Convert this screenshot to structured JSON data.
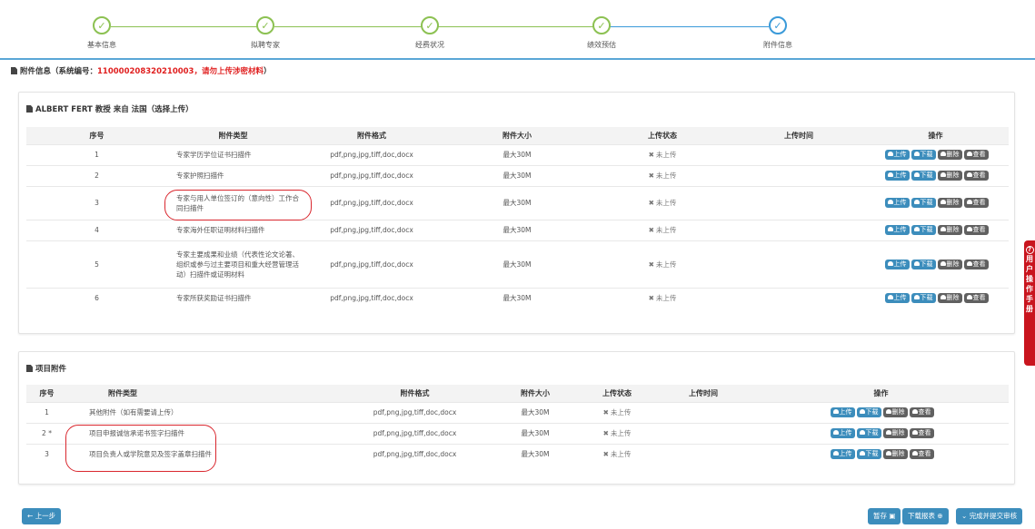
{
  "stepper": {
    "steps": [
      {
        "label": "基本信息"
      },
      {
        "label": "拟聘专家"
      },
      {
        "label": "经费状况"
      },
      {
        "label": "绩效预估"
      },
      {
        "label": "附件信息"
      }
    ]
  },
  "heading": {
    "prefix": "附件信息（系统编号：",
    "red_text": "110000208320210003，请勿上传涉密材料",
    "suffix": "）"
  },
  "expert_panel": {
    "title": "ALBERT FERT 教授 来自 法国（选择上传）",
    "columns": [
      "序号",
      "附件类型",
      "附件格式",
      "附件大小",
      "上传状态",
      "上传时间",
      "操作"
    ],
    "rows": [
      {
        "no": "1",
        "type": "专家学历学位证书扫描件",
        "format": "pdf,png,jpg,tiff,doc,docx",
        "size": "最大30M",
        "status": "未上传",
        "time": ""
      },
      {
        "no": "2",
        "type": "专家护照扫描件",
        "format": "pdf,png,jpg,tiff,doc,docx",
        "size": "最大30M",
        "status": "未上传",
        "time": ""
      },
      {
        "no": "3",
        "type": "专家与用人单位签订的（意向性）工作合同扫描件",
        "format": "pdf,png,jpg,tiff,doc,docx",
        "size": "最大30M",
        "status": "未上传",
        "time": ""
      },
      {
        "no": "4",
        "type": "专家海外任职证明材料扫描件",
        "format": "pdf,png,jpg,tiff,doc,docx",
        "size": "最大30M",
        "status": "未上传",
        "time": ""
      },
      {
        "no": "5",
        "type": "专家主要成果和业绩（代表性论文论著、组织或参与过主要项目和重大经营管理活动）扫描件或证明材料",
        "format": "pdf,png,jpg,tiff,doc,docx",
        "size": "最大30M",
        "status": "未上传",
        "time": ""
      },
      {
        "no": "6",
        "type": "专家所获奖励证书扫描件",
        "format": "pdf,png,jpg,tiff,doc,docx",
        "size": "最大30M",
        "status": "未上传",
        "time": ""
      }
    ]
  },
  "project_panel": {
    "title": "项目附件",
    "columns": [
      "序号",
      "附件类型",
      "附件格式",
      "附件大小",
      "上传状态",
      "上传时间",
      "操作"
    ],
    "rows": [
      {
        "no": "1",
        "type": "其他附件（如有需要请上传）",
        "format": "pdf,png,jpg,tiff,doc,docx",
        "size": "最大30M",
        "status": "未上传",
        "time": ""
      },
      {
        "no": "2 *",
        "type": "项目申报诚信承诺书签字扫描件",
        "format": "pdf,png,jpg,tiff,doc,docx",
        "size": "最大30M",
        "status": "未上传",
        "time": ""
      },
      {
        "no": "3",
        "type": "项目负责人或学院意见及签字盖章扫描件",
        "format": "pdf,png,jpg,tiff,doc,docx",
        "size": "最大30M",
        "status": "未上传",
        "time": ""
      }
    ]
  },
  "ops": {
    "upload": "上传",
    "download": "下载",
    "delete": "删除",
    "view": "查看"
  },
  "side_tab": {
    "text": "用户操作手册"
  },
  "footer": {
    "prev": "上一步",
    "save": "暂存",
    "download_report": "下载报表",
    "submit": "完成并提交审核"
  },
  "colors": {
    "primary": "#3c8dbc",
    "done": "#8cc152",
    "warning": "#e02020",
    "side_tab": "#c9151e"
  }
}
